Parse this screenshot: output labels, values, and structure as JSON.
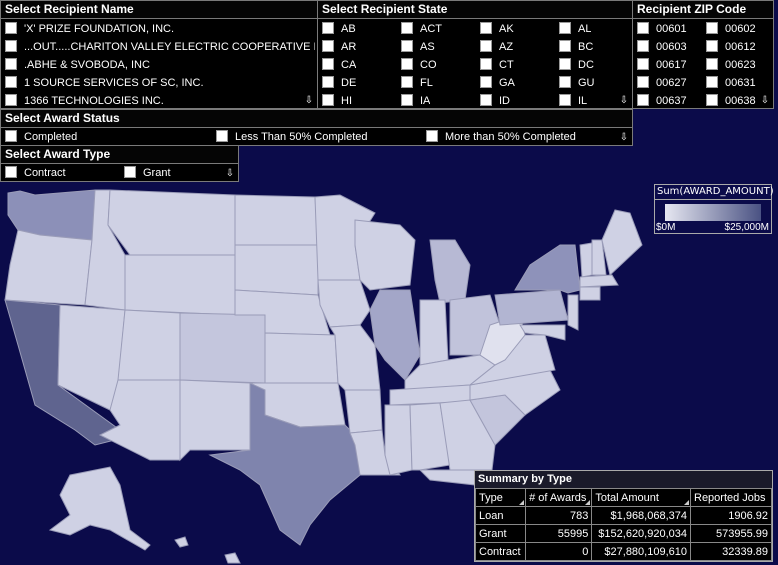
{
  "recipient_name": {
    "title": "Select Recipient Name",
    "items": [
      "'X' PRIZE FOUNDATION, INC.",
      "...OUT.....CHARITON VALLEY ELECTRIC COOPERATIVE INC",
      ".ABHE & SVOBODA, INC",
      "1 SOURCE SERVICES OF SC, INC.",
      "1366 TECHNOLOGIES INC."
    ]
  },
  "recipient_state": {
    "title": "Select Recipient State",
    "items": [
      "AB",
      "ACT",
      "AK",
      "AL",
      "AR",
      "AS",
      "AZ",
      "BC",
      "CA",
      "CO",
      "CT",
      "DC",
      "DE",
      "FL",
      "GA",
      "GU",
      "HI",
      "IA",
      "ID",
      "IL"
    ]
  },
  "recipient_zip": {
    "title": "Recipient ZIP Code",
    "items": [
      "00601",
      "00602",
      "00603",
      "00612",
      "00617",
      "00623",
      "00627",
      "00631",
      "00637",
      "00638"
    ]
  },
  "award_status": {
    "title": "Select Award Status",
    "items": [
      "Completed",
      "Less Than 50% Completed",
      "More than 50% Completed"
    ]
  },
  "award_type": {
    "title": "Select Award Type",
    "items": [
      "Contract",
      "Grant"
    ]
  },
  "legend": {
    "title": "Sum(AWARD_AMOUNT)",
    "min": "$0M",
    "max": "$25,000M",
    "color_low": "#e6e7f1",
    "color_high": "#4a5283"
  },
  "summary": {
    "title": "Summary by Type",
    "columns": [
      "Type",
      "# of Awards",
      "Total Amount",
      "Reported Jobs"
    ],
    "rows": [
      [
        "Loan",
        "783",
        "$1,968,068,374",
        "1906.92"
      ],
      [
        "Grant",
        "55995",
        "$152,620,920,034",
        "573955.99"
      ],
      [
        "Contract",
        "0",
        "$27,880,109,610",
        "32339.89"
      ]
    ]
  },
  "colors": {
    "background": "#0b0b4a",
    "panel": "#000000",
    "state_default": "#cfd1e4",
    "state_border": "#9a9cb8"
  }
}
